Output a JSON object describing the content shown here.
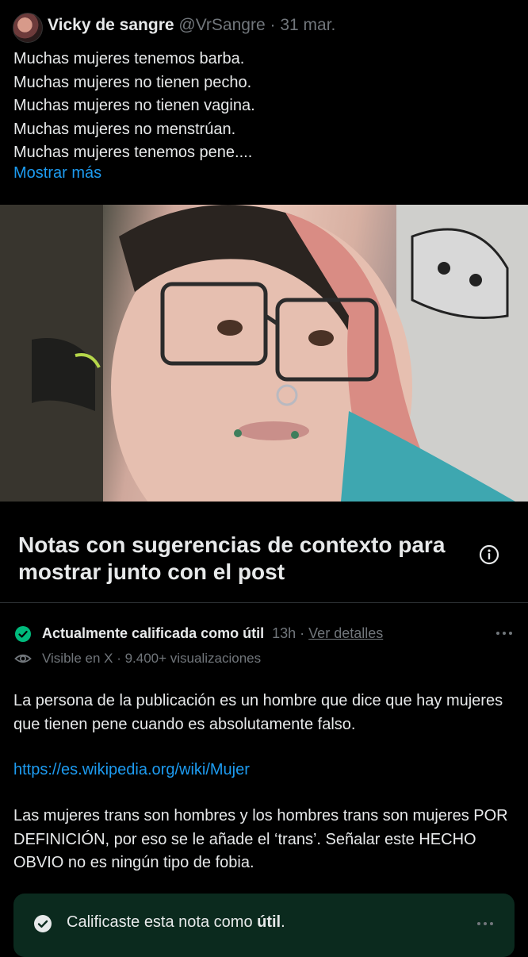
{
  "tweet": {
    "display_name": "Vicky de sangre",
    "handle": "@VrSangre",
    "separator": "·",
    "date": "31 mar.",
    "lines": [
      "Muchas mujeres tenemos barba.",
      "Muchas mujeres no tienen pecho.",
      "Muchas mujeres no tienen vagina.",
      "Muchas mujeres no menstrúan.",
      "Muchas mujeres tenemos pene...."
    ],
    "show_more": "Mostrar más"
  },
  "notes": {
    "title": "Notas con sugerencias de contexto para mostrar junto con el post",
    "info_icon": "info-circle-icon"
  },
  "note": {
    "status": "Actualmente calificada como útil",
    "age": "13h",
    "separator": "·",
    "details_link": "Ver detalles",
    "visibility": "Visible en X · 9.400+ visualizaciones",
    "paragraph1": "La persona de la publicación es un hombre que dice que hay mujeres que tienen pene cuando es absolutamente falso.",
    "link": "https://es.wikipedia.org/wiki/Mujer",
    "paragraph3": "Las mujeres trans son hombres y los hombres trans son mujeres POR DEFINICIÓN, por eso se le añade el ‘trans’. Señalar este HECHO OBVIO no es ningún tipo de fobia.",
    "status_color": "#00ba7c"
  },
  "rating": {
    "prefix": "Calificaste esta nota como",
    "value": "útil",
    "suffix": "."
  },
  "colors": {
    "background": "#000000",
    "text": "#e7e9ea",
    "muted": "#71767b",
    "link": "#1d9bf0",
    "rating_bg": "#0b2a1e"
  }
}
